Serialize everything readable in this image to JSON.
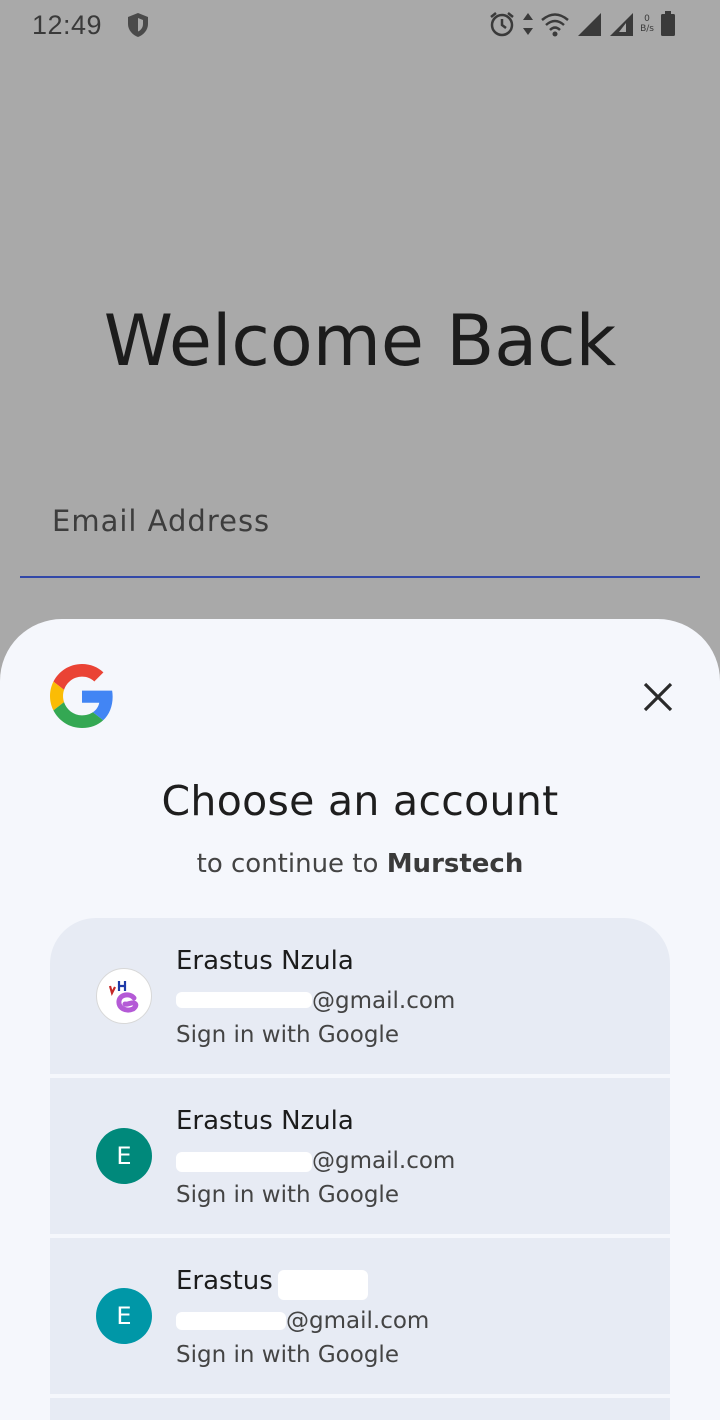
{
  "status_bar": {
    "time": "12:49",
    "icons": [
      "shield-icon",
      "alarm-icon",
      "data-arrows-icon",
      "wifi-icon",
      "signal-icon",
      "signal-icon",
      "battery-icon"
    ],
    "net_speed_value": "0",
    "net_speed_unit": "B/s"
  },
  "background_app": {
    "heading": "Welcome Back",
    "email_label": "Email Address",
    "accent_color": "#3248a8"
  },
  "account_chooser": {
    "logo": "google-logo",
    "close_icon": "close-icon",
    "title": "Choose an account",
    "subtitle_prefix": "to continue to",
    "app_name": "Murstech",
    "accounts": [
      {
        "name": "Erastus Nzula",
        "email_suffix": "@gmail.com",
        "action": "Sign in with Google",
        "avatar_type": "image",
        "avatar_letter": ""
      },
      {
        "name": "Erastus Nzula",
        "email_suffix": "@gmail.com",
        "action": "Sign in with Google",
        "avatar_type": "letter",
        "avatar_letter": "E",
        "avatar_color": "#00897b"
      },
      {
        "name": "Erastus",
        "email_suffix": "@gmail.com",
        "action": "Sign in with Google",
        "avatar_type": "letter",
        "avatar_letter": "E",
        "avatar_color": "#0097a7"
      }
    ]
  }
}
